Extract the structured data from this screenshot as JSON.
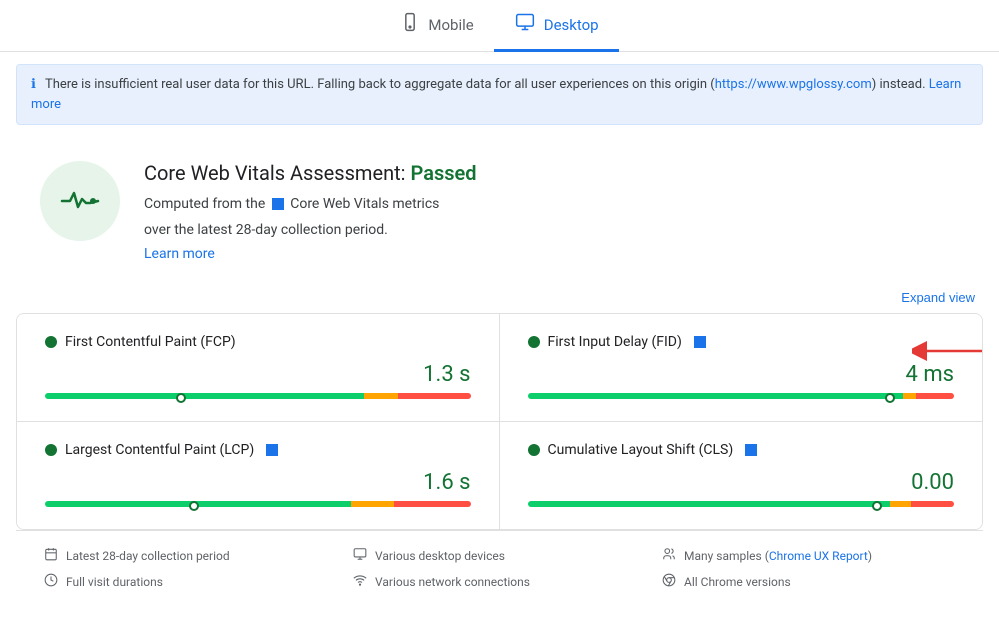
{
  "tabs": [
    {
      "id": "mobile",
      "label": "Mobile",
      "icon": "📱",
      "active": false
    },
    {
      "id": "desktop",
      "label": "Desktop",
      "icon": "🖥",
      "active": true
    }
  ],
  "banner": {
    "text": "There is insufficient real user data for this URL. Falling back to aggregate data for all user experiences on this origin (",
    "link_url": "https://www.wpglossy.com",
    "link_text": "https://www.wpglossy.com",
    "text_after": ") instead. ",
    "learn_more_text": "Learn more",
    "learn_more_url": "#"
  },
  "assessment": {
    "title": "Core Web Vitals Assessment:",
    "status": "Passed",
    "description_pre": "Computed from the",
    "description_post": "Core Web Vitals metrics",
    "description_line2": "over the latest 28-day collection period.",
    "learn_more_label": "Learn more"
  },
  "expand_view_label": "Expand view",
  "metrics": [
    {
      "id": "fcp",
      "title": "First Contentful Paint (FCP)",
      "value": "1.3 s",
      "dot_color": "#137333",
      "has_badge": false,
      "has_arrow": false,
      "green_flex": 75,
      "orange_flex": 8,
      "red_flex": 17,
      "marker_left": "32%"
    },
    {
      "id": "fid",
      "title": "First Input Delay (FID)",
      "value": "4 ms",
      "dot_color": "#137333",
      "has_badge": true,
      "has_arrow": true,
      "green_flex": 88,
      "orange_flex": 3,
      "red_flex": 9,
      "marker_left": "85%"
    },
    {
      "id": "lcp",
      "title": "Largest Contentful Paint (LCP)",
      "value": "1.6 s",
      "dot_color": "#137333",
      "has_badge": true,
      "has_arrow": false,
      "green_flex": 72,
      "orange_flex": 10,
      "red_flex": 18,
      "marker_left": "35%"
    },
    {
      "id": "cls",
      "title": "Cumulative Layout Shift (CLS)",
      "value": "0.00",
      "dot_color": "#137333",
      "has_badge": true,
      "has_arrow": false,
      "green_flex": 85,
      "orange_flex": 5,
      "red_flex": 10,
      "marker_left": "82%"
    }
  ],
  "footer": {
    "items": [
      {
        "icon": "📅",
        "text": "Latest 28-day collection period",
        "link": null,
        "link_text": null
      },
      {
        "icon": "🖥",
        "text": "Various desktop devices",
        "link": null,
        "link_text": null
      },
      {
        "icon": "👥",
        "text": "Many samples (",
        "link": "https://developers.google.com/web/tools/chrome-user-experience-report",
        "link_text": "Chrome UX Report",
        "text_after": ")"
      },
      {
        "icon": "⏱",
        "text": "Full visit durations",
        "link": null,
        "link_text": null
      },
      {
        "icon": "📶",
        "text": "Various network connections",
        "link": null,
        "link_text": null
      },
      {
        "icon": "⚙",
        "text": "All Chrome versions",
        "link": null,
        "link_text": null
      }
    ]
  }
}
